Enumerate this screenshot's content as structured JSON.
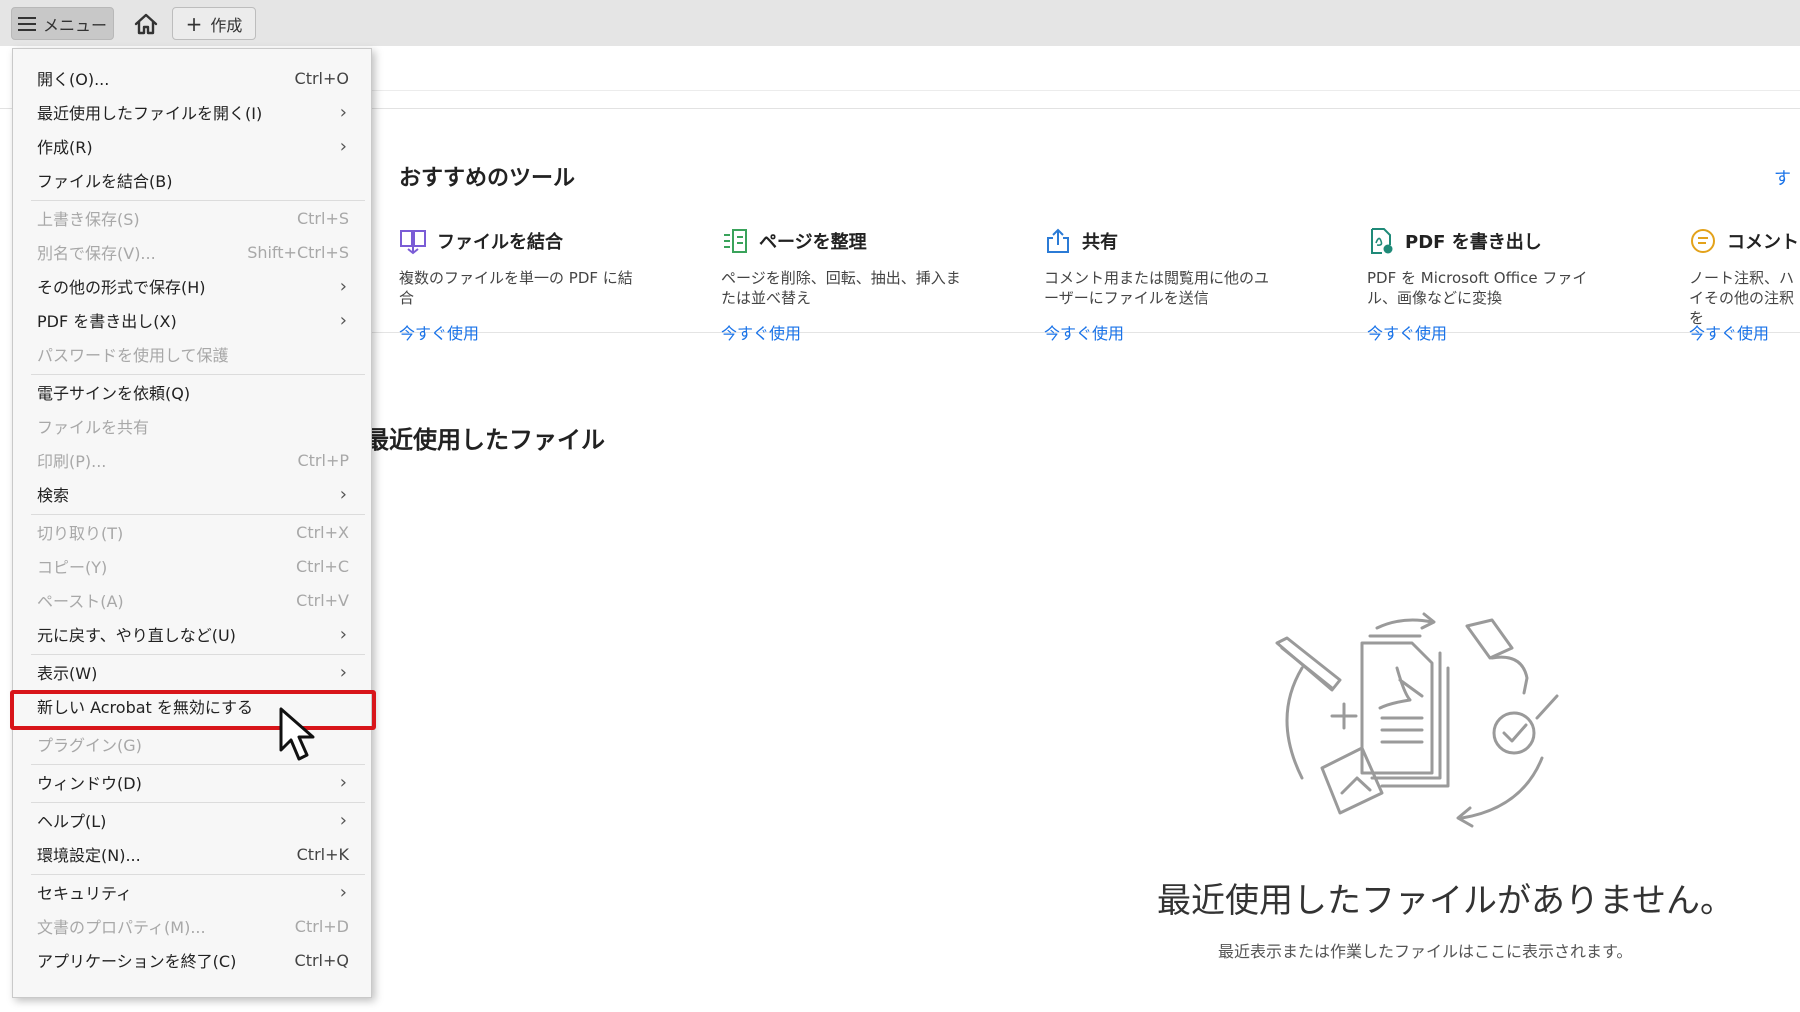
{
  "toolbar": {
    "menu_label": "メニュー",
    "home_icon": "home-icon",
    "create_label": "作成"
  },
  "menu": {
    "items": [
      {
        "label": "開く(O)...",
        "shortcut": "Ctrl+O",
        "disabled": false,
        "submenu": false
      },
      {
        "label": "最近使用したファイルを開く(I)",
        "shortcut": "",
        "disabled": false,
        "submenu": true
      },
      {
        "label": "作成(R)",
        "shortcut": "",
        "disabled": false,
        "submenu": true
      },
      {
        "label": "ファイルを結合(B)",
        "shortcut": "",
        "disabled": false,
        "submenu": false
      },
      {
        "label": "上書き保存(S)",
        "shortcut": "Ctrl+S",
        "disabled": true,
        "submenu": false
      },
      {
        "label": "別名で保存(V)...",
        "shortcut": "Shift+Ctrl+S",
        "disabled": true,
        "submenu": false
      },
      {
        "label": "その他の形式で保存(H)",
        "shortcut": "",
        "disabled": false,
        "submenu": true
      },
      {
        "label": "PDF を書き出し(X)",
        "shortcut": "",
        "disabled": false,
        "submenu": true
      },
      {
        "label": "パスワードを使用して保護",
        "shortcut": "",
        "disabled": true,
        "submenu": false
      },
      {
        "label": "電子サインを依頼(Q)",
        "shortcut": "",
        "disabled": false,
        "submenu": false
      },
      {
        "label": "ファイルを共有",
        "shortcut": "",
        "disabled": true,
        "submenu": false
      },
      {
        "label": "印刷(P)...",
        "shortcut": "Ctrl+P",
        "disabled": true,
        "submenu": false
      },
      {
        "label": "検索",
        "shortcut": "",
        "disabled": false,
        "submenu": true
      },
      {
        "label": "切り取り(T)",
        "shortcut": "Ctrl+X",
        "disabled": true,
        "submenu": false
      },
      {
        "label": "コピー(Y)",
        "shortcut": "Ctrl+C",
        "disabled": true,
        "submenu": false
      },
      {
        "label": "ペースト(A)",
        "shortcut": "Ctrl+V",
        "disabled": true,
        "submenu": false
      },
      {
        "label": "元に戻す、やり直しなど(U)",
        "shortcut": "",
        "disabled": false,
        "submenu": true
      },
      {
        "label": "表示(W)",
        "shortcut": "",
        "disabled": false,
        "submenu": true
      },
      {
        "label": "新しい Acrobat を無効にする",
        "shortcut": "",
        "disabled": false,
        "submenu": false
      },
      {
        "label": "プラグイン(G)",
        "shortcut": "",
        "disabled": true,
        "submenu": false
      },
      {
        "label": "ウィンドウ(D)",
        "shortcut": "",
        "disabled": false,
        "submenu": true
      },
      {
        "label": "ヘルプ(L)",
        "shortcut": "",
        "disabled": false,
        "submenu": true
      },
      {
        "label": "環境設定(N)...",
        "shortcut": "Ctrl+K",
        "disabled": false,
        "submenu": false
      },
      {
        "label": "セキュリティ",
        "shortcut": "",
        "disabled": false,
        "submenu": true
      },
      {
        "label": "文書のプロパティ(M)...",
        "shortcut": "Ctrl+D",
        "disabled": true,
        "submenu": false
      },
      {
        "label": "アプリケーションを終了(C)",
        "shortcut": "Ctrl+Q",
        "disabled": false,
        "submenu": false
      }
    ]
  },
  "tools": {
    "title": "おすすめのツール",
    "see_all": "す",
    "cards": [
      {
        "name": "ファイルを結合",
        "desc": "複数のファイルを単一の PDF に結合",
        "link": "今すぐ使用",
        "icon": "combine-files-icon"
      },
      {
        "name": "ページを整理",
        "desc": "ページを削除、回転、抽出、挿入または並べ替え",
        "link": "今すぐ使用",
        "icon": "organize-pages-icon"
      },
      {
        "name": "共有",
        "desc": "コメント用または閲覧用に他のユーザーにファイルを送信",
        "link": "今すぐ使用",
        "icon": "share-icon"
      },
      {
        "name": "PDF を書き出し",
        "desc": "PDF を Microsoft Office ファイル、画像などに変換",
        "link": "今すぐ使用",
        "icon": "export-pdf-icon"
      },
      {
        "name": "コメント",
        "desc": "ノート注釈、ハイその他の注釈を",
        "link": "今すぐ使用",
        "icon": "comment-icon"
      }
    ]
  },
  "recent": {
    "title": "最近使用したファイル",
    "empty_title": "最近使用したファイルがありません。",
    "empty_sub": "最近表示または作業したファイルはここに表示されます。"
  },
  "colors": {
    "accent": "#1a73e8",
    "highlight": "#d8151a",
    "menu_bg": "#f7f7f7",
    "toolbar_bg": "#e5e5e5"
  }
}
